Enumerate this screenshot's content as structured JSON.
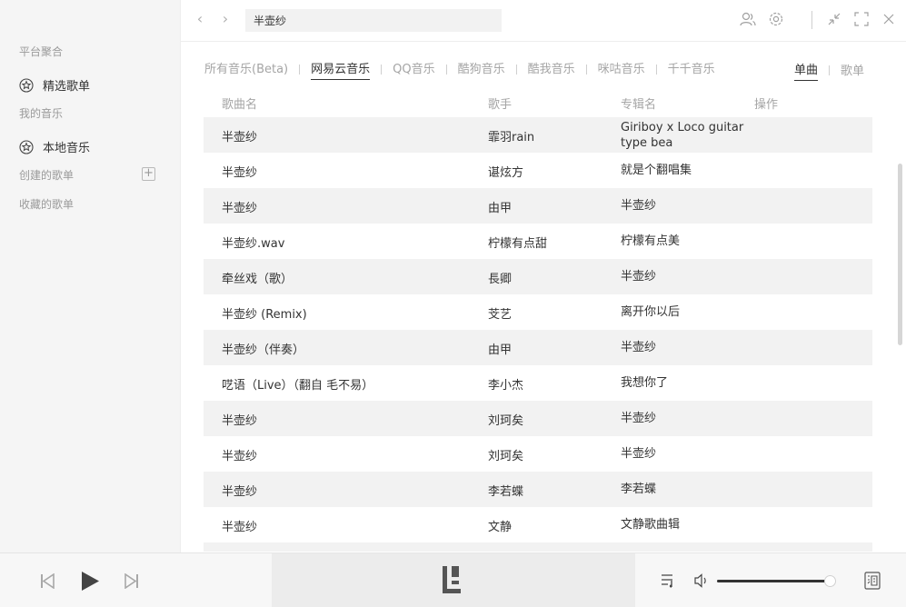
{
  "sidebar": {
    "section_platform": "平台聚合",
    "featured_label": "精选歌单",
    "section_my_music": "我的音乐",
    "local_label": "本地音乐",
    "section_created": "创建的歌单",
    "add_symbol": "+",
    "section_favorites": "收藏的歌单"
  },
  "topbar": {
    "back_symbol": "‹",
    "forward_symbol": "›",
    "search_value": "半壶纱"
  },
  "tabs": {
    "items": [
      "所有音乐(Beta)",
      "网易云音乐",
      "QQ音乐",
      "酷狗音乐",
      "酷我音乐",
      "咪咕音乐",
      "千千音乐"
    ],
    "active_index": 1,
    "mode_single": "单曲",
    "mode_playlist": "歌单"
  },
  "table": {
    "headers": {
      "title": "歌曲名",
      "artist": "歌手",
      "album": "专辑名",
      "action": "操作"
    },
    "rows": [
      {
        "title": "半壶纱",
        "artist": "霏羽rain",
        "album": "Giriboy x Loco guitar type bea"
      },
      {
        "title": "半壶纱",
        "artist": "谌炫方",
        "album": "就是个翻唱集"
      },
      {
        "title": "半壶纱",
        "artist": "由甲",
        "album": "半壶纱"
      },
      {
        "title": "半壶纱.wav",
        "artist": "柠檬有点甜",
        "album": "柠檬有点美"
      },
      {
        "title": "牵丝戏（歌）",
        "artist": "長卿",
        "album": "半壶纱"
      },
      {
        "title": "半壶纱 (Remix)",
        "artist": "芠艺",
        "album": "离开你以后"
      },
      {
        "title": "半壶纱（伴奏）",
        "artist": "由甲",
        "album": "半壶纱"
      },
      {
        "title": "呓语（Live）（翻自 毛不易）",
        "artist": "李小杰",
        "album": "我想你了"
      },
      {
        "title": "半壶纱",
        "artist": "刘珂矣",
        "album": "半壶纱"
      },
      {
        "title": "半壶纱",
        "artist": "刘珂矣",
        "album": "半壶纱"
      },
      {
        "title": "半壶纱",
        "artist": "李若蝶",
        "album": "李若蝶"
      },
      {
        "title": "半壶纱",
        "artist": "文静",
        "album": "文静歌曲辑"
      }
    ]
  },
  "player": {
    "volume": 0.95
  },
  "icons": {
    "star": "star-icon",
    "user": "user-icon",
    "settings": "gear-icon",
    "minimize": "minimize-icon",
    "fullscreen": "fullscreen-icon",
    "close": "close-icon",
    "prev": "prev-icon",
    "play": "play-icon",
    "next": "next-icon",
    "playlist": "playlist-icon",
    "volume": "volume-icon",
    "lyrics": "lyrics-icon"
  }
}
